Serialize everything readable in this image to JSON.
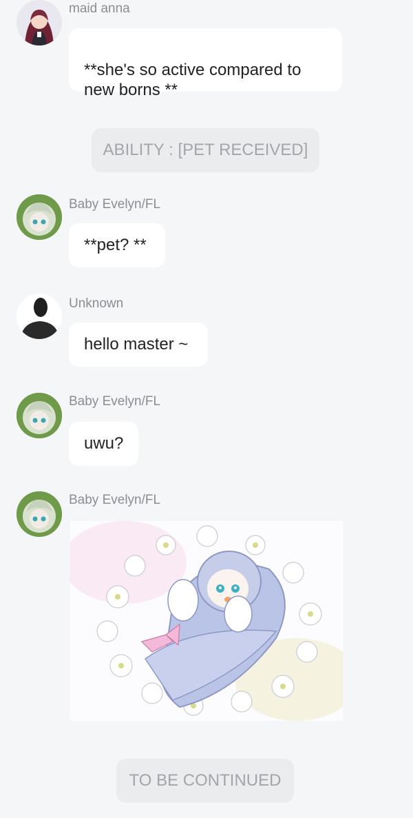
{
  "messages": [
    {
      "sender": "maid anna",
      "text": "**she's so active compared to\nnew borns **"
    },
    {
      "sender": "Baby Evelyn/FL",
      "text": "**pet? **"
    },
    {
      "sender": "Unknown",
      "text": "hello master ~"
    },
    {
      "sender": "Baby Evelyn/FL",
      "text": "uwu?"
    },
    {
      "sender": "Baby Evelyn/FL",
      "image": "swaddled-baby-illustration"
    }
  ],
  "system_notices": [
    "ABILITY : [PET RECEIVED]",
    "TO BE CONTINUED"
  ],
  "colors": {
    "background": "#f5f6f8",
    "bubble": "#ffffff",
    "system_pill": "#ebecee",
    "sender_text": "#8a8d92",
    "system_text": "#a2a5a9"
  }
}
